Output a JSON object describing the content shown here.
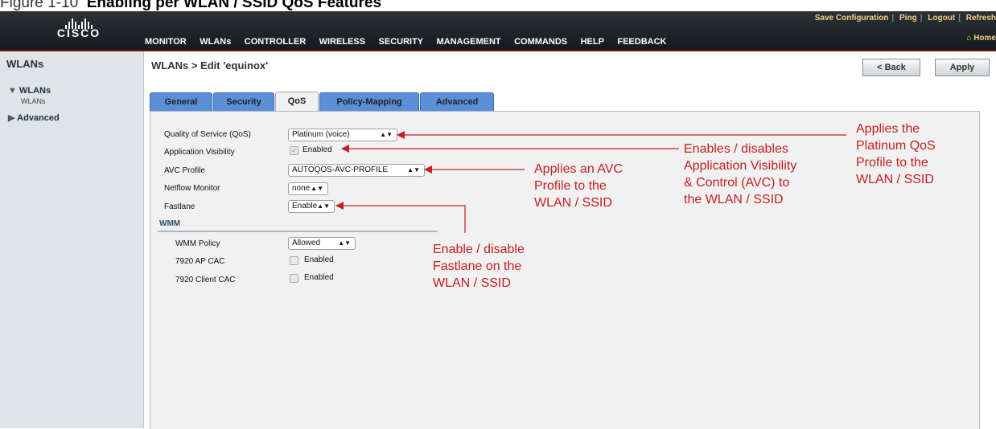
{
  "caption": {
    "prefix": "Figure 1-10",
    "title": "Enabling per WLAN / SSID QoS Features"
  },
  "header": {
    "logo_text": "CISCO",
    "nav": [
      "MONITOR",
      "WLANs",
      "CONTROLLER",
      "WIRELESS",
      "SECURITY",
      "MANAGEMENT",
      "COMMANDS",
      "HELP",
      "FEEDBACK"
    ],
    "active_nav": "WLANs",
    "links": [
      "Save Configuration",
      "Ping",
      "Logout",
      "Refresh"
    ],
    "home": "Home"
  },
  "sidebar": {
    "title": "WLANs",
    "items": [
      {
        "label": "WLANs",
        "sub": "WLANs",
        "expanded": true
      },
      {
        "label": "Advanced",
        "expanded": false
      }
    ]
  },
  "page": {
    "title": "WLANs > Edit  'equinox'",
    "back_label": "< Back",
    "apply_label": "Apply"
  },
  "tabs": [
    "General",
    "Security",
    "QoS",
    "Policy-Mapping",
    "Advanced"
  ],
  "active_tab": "QoS",
  "form": {
    "qos": {
      "label": "Quality of Service (QoS)",
      "value": "Platinum (voice)"
    },
    "app_visibility": {
      "label": "Application Visibility",
      "checkbox_label": "Enabled",
      "checked": true
    },
    "avc_profile": {
      "label": "AVC Profile",
      "value": "AUTOQOS-AVC-PROFILE"
    },
    "netflow": {
      "label": "Netflow Monitor",
      "value": "none"
    },
    "fastlane": {
      "label": "Fastlane",
      "value": "Enable"
    },
    "wmm_section": "WMM",
    "wmm_policy": {
      "label": "WMM Policy",
      "value": "Allowed"
    },
    "ap_cac": {
      "label": "7920 AP CAC",
      "checkbox_label": "Enabled",
      "checked": false
    },
    "client_cac": {
      "label": "7920 Client CAC",
      "checkbox_label": "Enabled",
      "checked": false
    }
  },
  "annotations": {
    "platinum": [
      "Applies the",
      "Platinum QoS",
      "Profile to the",
      "WLAN / SSID"
    ],
    "avc_enable": [
      "Enables / disables",
      "Application Visibility",
      "& Control (AVC) to",
      "the WLAN / SSID"
    ],
    "avc_profile": [
      "Applies an AVC",
      "Profile to the",
      "WLAN / SSID"
    ],
    "fastlane": [
      "Enable / disable",
      "Fastlane on the",
      "WLAN / SSID"
    ]
  },
  "colors": {
    "annotation": "#c32020",
    "tab": "#5b8fd8",
    "header": "#1e2428",
    "active_underline": "#f2a53d"
  }
}
